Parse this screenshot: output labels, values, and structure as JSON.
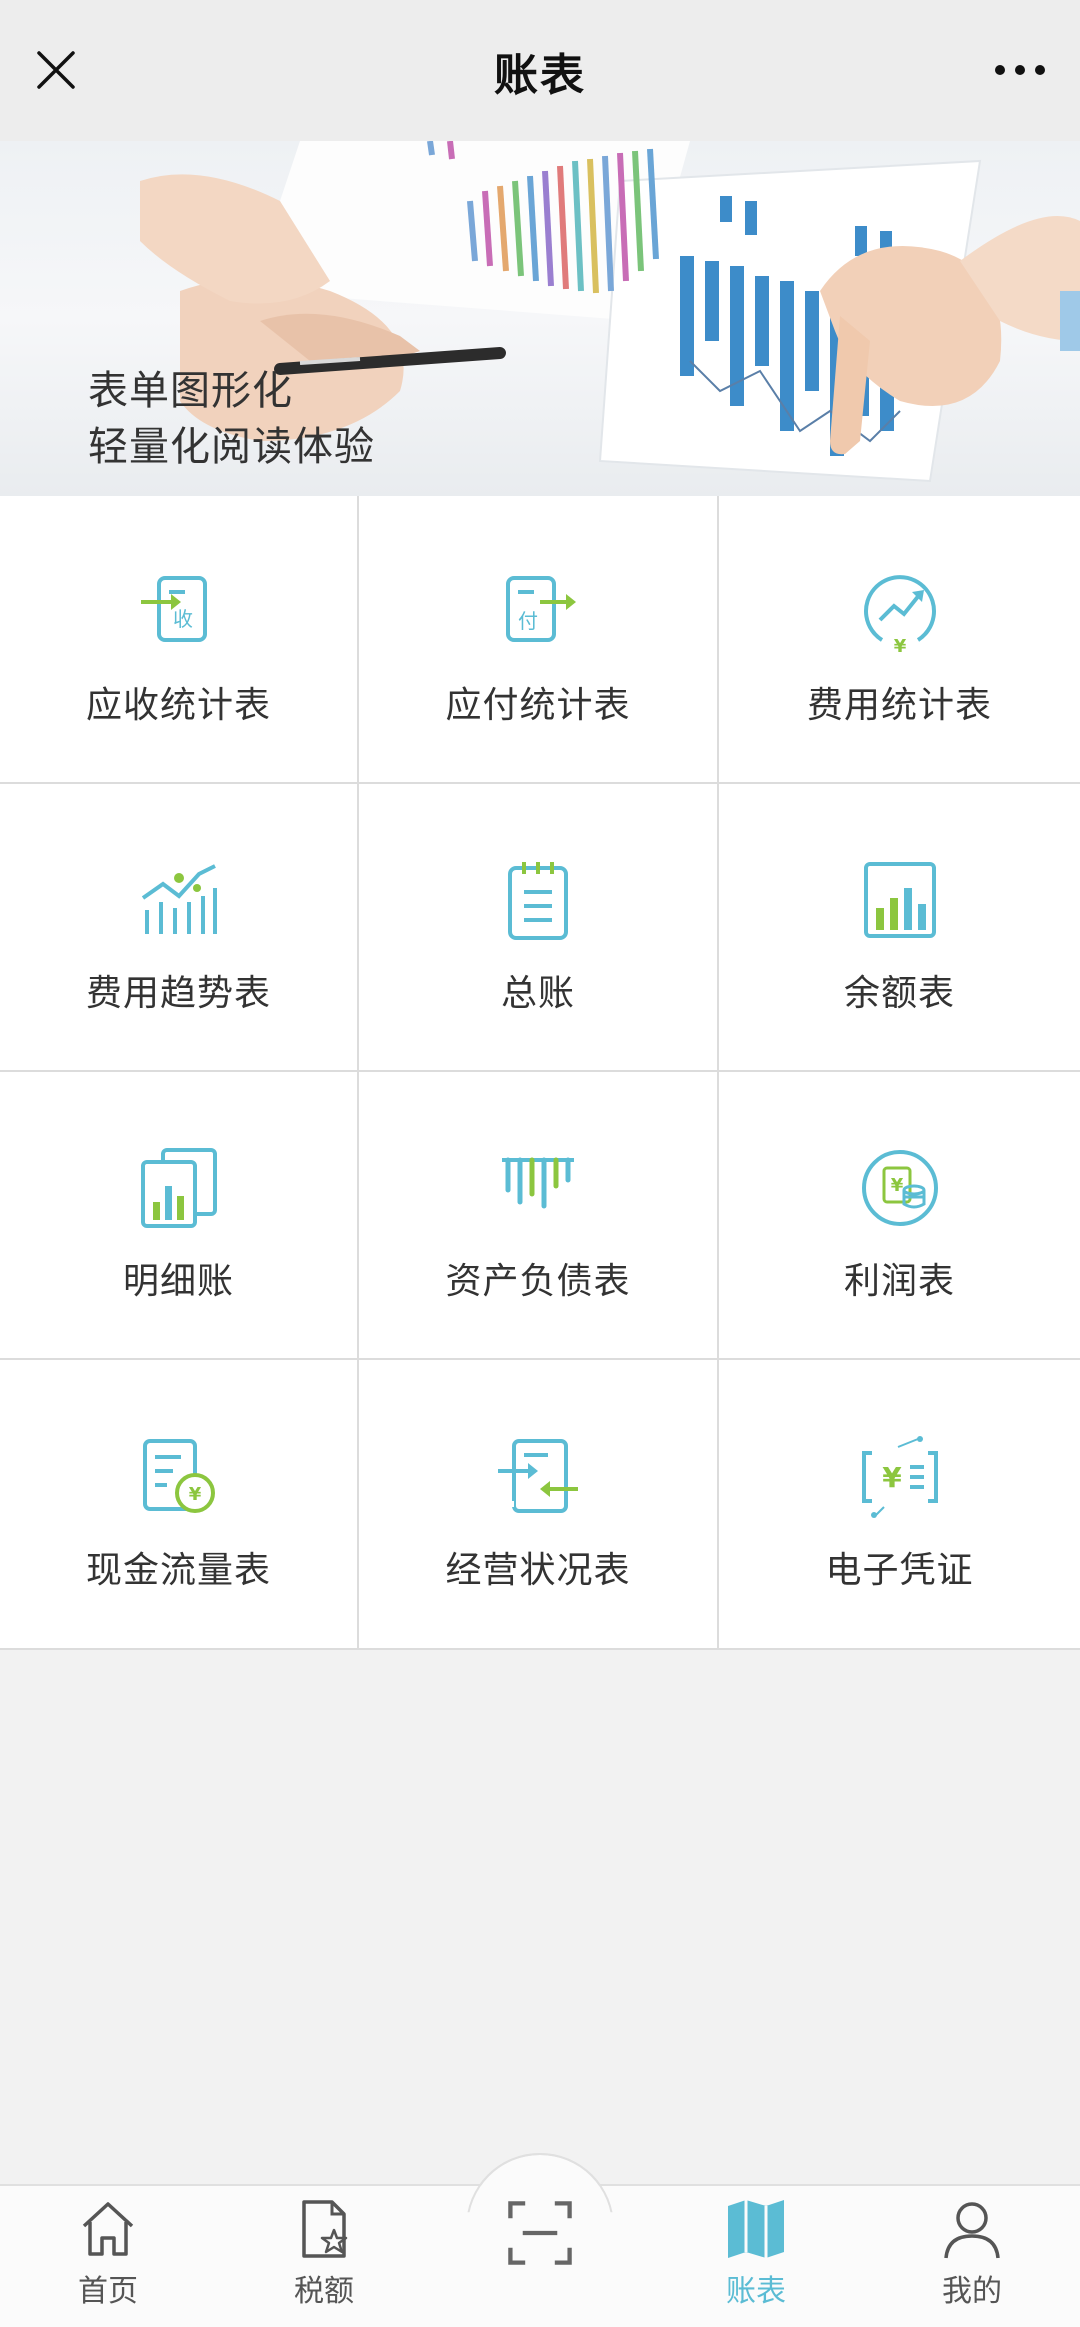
{
  "header": {
    "title": "账表"
  },
  "banner": {
    "line1": "表单图形化",
    "line2": "轻量化阅读体验"
  },
  "grid": [
    {
      "label": "应收统计表",
      "icon": "receivable-doc-icon"
    },
    {
      "label": "应付统计表",
      "icon": "payable-doc-icon"
    },
    {
      "label": "费用统计表",
      "icon": "expense-trend-circle-icon"
    },
    {
      "label": "费用趋势表",
      "icon": "expense-trend-icon"
    },
    {
      "label": "总账",
      "icon": "ledger-notepad-icon"
    },
    {
      "label": "余额表",
      "icon": "balance-bar-chart-icon"
    },
    {
      "label": "明细账",
      "icon": "detail-ledger-icon"
    },
    {
      "label": "资产负债表",
      "icon": "balance-sheet-icon"
    },
    {
      "label": "利润表",
      "icon": "profit-coin-icon"
    },
    {
      "label": "现金流量表",
      "icon": "cashflow-doc-icon"
    },
    {
      "label": "经营状况表",
      "icon": "operations-doc-icon"
    },
    {
      "label": "电子凭证",
      "icon": "e-voucher-icon"
    }
  ],
  "icon_text": {
    "receivable": "收",
    "payable": "付",
    "yuan": "¥"
  },
  "tabbar": {
    "items": [
      {
        "label": "首页",
        "icon": "home-icon"
      },
      {
        "label": "税额",
        "icon": "tax-doc-icon"
      },
      {
        "label": "账表",
        "icon": "map-book-icon",
        "active": true
      },
      {
        "label": "我的",
        "icon": "user-icon"
      }
    ],
    "center": "scan-icon"
  },
  "colors": {
    "teal": "#5bbcd4",
    "green": "#8cc63f",
    "active": "#5bbcd4",
    "text": "#333333"
  }
}
